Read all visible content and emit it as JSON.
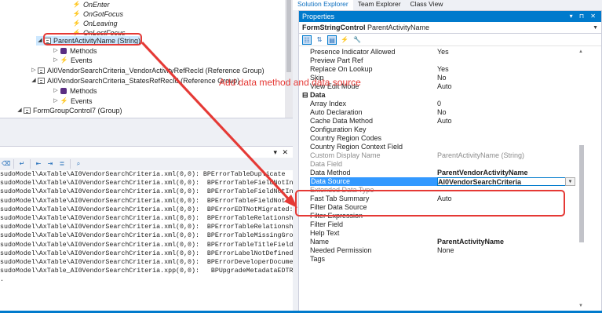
{
  "tree": {
    "nodes": [
      {
        "label": "OnEnter",
        "icon": "event-bolt-icon",
        "italic": true
      },
      {
        "label": "OnGotFocus",
        "icon": "event-bolt-icon",
        "italic": true
      },
      {
        "label": "OnLeaving",
        "icon": "event-bolt-icon",
        "italic": true
      },
      {
        "label": "OnLostFocus",
        "icon": "event-bolt-icon",
        "italic": true
      },
      {
        "label": "ParentActivityName (String)",
        "icon": "string-control-icon",
        "expander": "◢",
        "selected": true
      },
      {
        "label": "Methods",
        "icon": "methods-icon",
        "expander": "▷"
      },
      {
        "label": "Events",
        "icon": "event-bolt-icon",
        "expander": "▷"
      },
      {
        "label": "AI0VendorSearchCriteria_VendorActivityRefRecId (Reference Group)",
        "icon": "reference-group-icon",
        "expander": "▷"
      },
      {
        "label": "AI0VendorSearchCriteria_StatesRefRecId (Reference Group)",
        "icon": "reference-group-icon",
        "expander": "◢"
      },
      {
        "label": "Methods",
        "icon": "methods-icon",
        "expander": "▷"
      },
      {
        "label": "Events",
        "icon": "event-bolt-icon",
        "expander": "▷"
      },
      {
        "label": "FormGroupControl7 (Group)",
        "icon": "group-icon",
        "expander": "◢"
      }
    ]
  },
  "output": {
    "title_controls": "▾ ✕",
    "toolbar_icons": [
      "clear-icon",
      "wrap-icon",
      "prev-icon",
      "next-icon",
      "filter-icon",
      "find-icon"
    ],
    "lines": [
      "sudoModel\\AxTable\\AI0VendorSearchCriteria.xml(0,0): BPErrorTableDuplicate",
      "sudoModel\\AxTable\\AI0VendorSearchCriteria.xml(0,0):  BPErrorTableFieldNotInF",
      "sudoModel\\AxTable\\AI0VendorSearchCriteria.xml(0,0):  BPErrorTableFieldNotInF",
      "sudoModel\\AxTable\\AI0VendorSearchCriteria.xml(0,0):  BPErrorTableFieldNotInF",
      "sudoModel\\AxTable\\AI0VendorSearchCriteria.xml(0,0):  BPErrorEDTNotMigrated: E",
      "sudoModel\\AxTable\\AI0VendorSearchCriteria.xml(0,0):  BPErrorTableRelationship",
      "sudoModel\\AxTable\\AI0VendorSearchCriteria.xml(0,0):  BPErrorTableRelationship",
      "sudoModel\\AxTable\\AI0VendorSearchCriteria.xml(0,0):  BPErrorTableMissingGroup",
      "sudoModel\\AxTable\\AI0VendorSearchCriteria.xml(0,0):  BPErrorTableTitleField1N",
      "sudoModel\\AxTable\\AI0VendorSearchCriteria.xml(0,0):  BPErrorLabelNotDefined: ",
      "sudoModel\\AxTable\\AI0VendorSearchCriteria.xml(0,0):  BPErrorDeveloperDocument",
      "sudoModel\\AxTable_AI0VendorSearchCriteria.xpp(0,0):   BPUpgradeMetadataEDTRela",
      "."
    ]
  },
  "tool_tabs": [
    "Solution Explorer",
    "Team Explorer",
    "Class View"
  ],
  "properties": {
    "title": "Properties",
    "title_controls": "▾ ⊓ ✕",
    "object_type": "FormStringControl",
    "object_name": "ParentActivityName",
    "toolbar_icons": [
      "categorized-icon",
      "alphabetical-icon",
      "properties-page-icon",
      "events-icon",
      "wrench-icon"
    ],
    "rows": [
      {
        "name": "Presence Indicator Allowed",
        "value": "Yes"
      },
      {
        "name": "Preview Part Ref",
        "value": ""
      },
      {
        "name": "Replace On Lookup",
        "value": "Yes"
      },
      {
        "name": "Skip",
        "value": "No"
      },
      {
        "name": "View Edit Mode",
        "value": "Auto"
      },
      {
        "category": true,
        "name": "Data"
      },
      {
        "name": "Array Index",
        "value": "0"
      },
      {
        "name": "Auto Declaration",
        "value": "No"
      },
      {
        "name": "Cache Data Method",
        "value": "Auto"
      },
      {
        "name": "Configuration Key",
        "value": ""
      },
      {
        "name": "Country Region Codes",
        "value": ""
      },
      {
        "name": "Country Region Context Field",
        "value": ""
      },
      {
        "name": "Custom Display Name",
        "value": "ParentActivityName (String)",
        "gray": true
      },
      {
        "name": "Data Field",
        "value": "",
        "gray": true
      },
      {
        "name": "Data Method",
        "value": "ParentVendorActivityName",
        "bold": true
      },
      {
        "name": "Data Source",
        "value": "AI0VendorSearchCriteria",
        "bold": true,
        "selected": true
      },
      {
        "name": "Extended Data Type",
        "value": "",
        "gray": true
      },
      {
        "name": "Fast Tab Summary",
        "value": "Auto"
      },
      {
        "name": "Filter Data Source",
        "value": ""
      },
      {
        "name": "Filter Expression",
        "value": ""
      },
      {
        "name": "Filter Field",
        "value": ""
      },
      {
        "name": "Help Text",
        "value": ""
      },
      {
        "name": "Name",
        "value": "ParentActivityName",
        "bold": true
      },
      {
        "name": "Needed Permission",
        "value": "None"
      },
      {
        "name": "Tags",
        "value": ""
      }
    ]
  },
  "annotation": {
    "text": "Add data method and data source",
    "color": "#e53935"
  },
  "colors": {
    "accent": "#007acc",
    "selection": "#3399ff",
    "annotation": "#e53935"
  }
}
